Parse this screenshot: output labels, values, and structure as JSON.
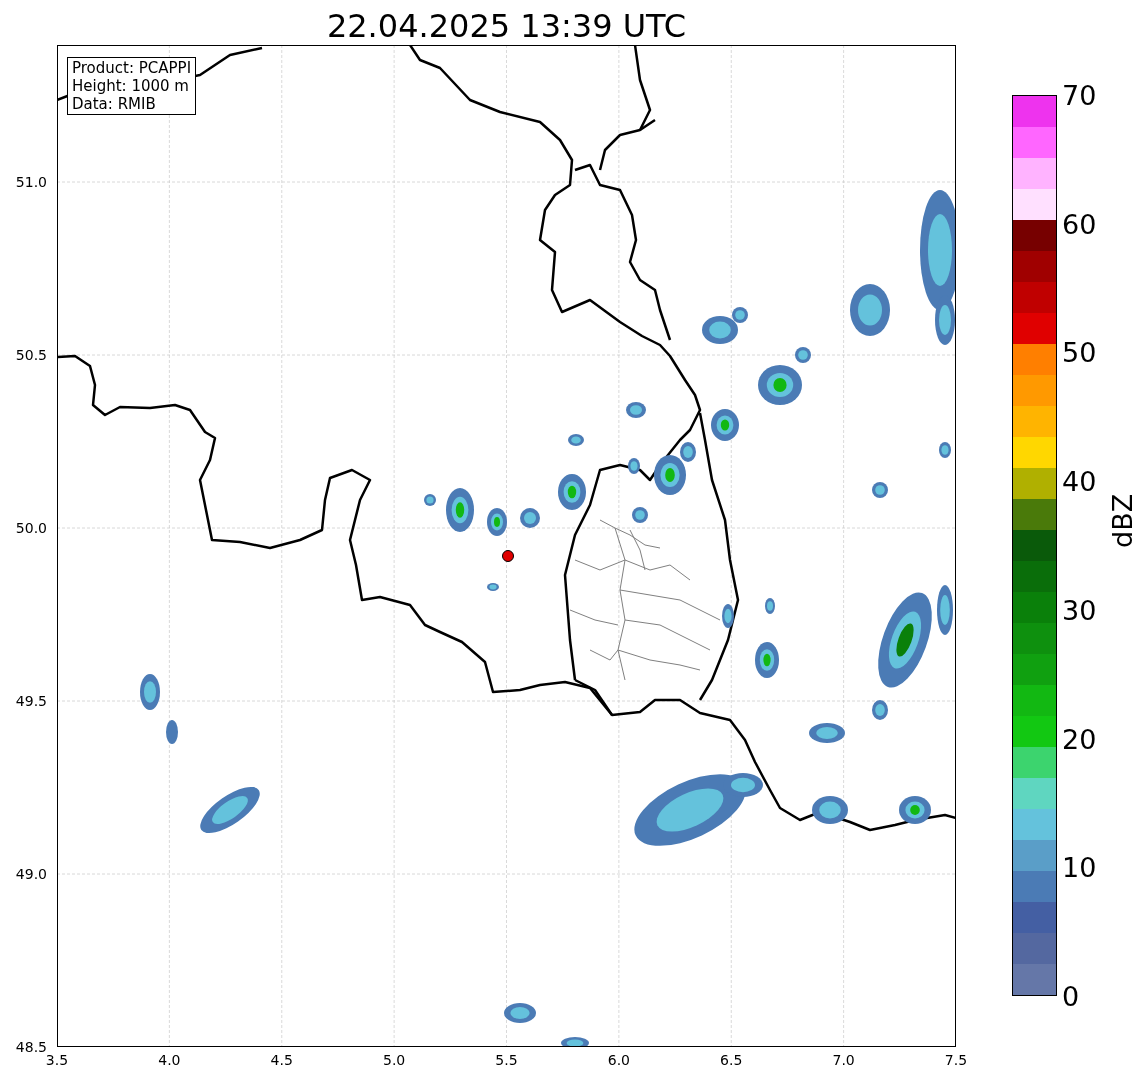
{
  "title": "22.04.2025 13:39 UTC",
  "info_box": [
    "Product: PCAPPI",
    "Height: 1000 m",
    "Data: RMIB"
  ],
  "map": {
    "xticks": [
      "3.5",
      "4.0",
      "4.5",
      "5.0",
      "5.5",
      "6.0",
      "6.5",
      "7.0",
      "7.5"
    ],
    "yticks": [
      "51.0",
      "50.5",
      "50.0",
      "49.5",
      "49.0",
      "48.5"
    ]
  },
  "colorbar": {
    "label": "dBZ",
    "ticks": [
      "70",
      "60",
      "50",
      "40",
      "30",
      "20",
      "10",
      "0"
    ],
    "bins": [
      {
        "color": "#ee33ee"
      },
      {
        "color": "#ff66ff"
      },
      {
        "color": "#ffb3ff"
      },
      {
        "color": "#ffe0ff"
      },
      {
        "color": "#770000"
      },
      {
        "color": "#a00000"
      },
      {
        "color": "#c00000"
      },
      {
        "color": "#e00000"
      },
      {
        "color": "#ff7f00"
      },
      {
        "color": "#ff9900"
      },
      {
        "color": "#ffb400"
      },
      {
        "color": "#ffd700"
      },
      {
        "color": "#b0b000"
      },
      {
        "color": "#4a7a0a"
      },
      {
        "color": "#0a5a0a"
      },
      {
        "color": "#0a6e0a"
      },
      {
        "color": "#0a800a"
      },
      {
        "color": "#0e900e"
      },
      {
        "color": "#10a010"
      },
      {
        "color": "#12b812"
      },
      {
        "color": "#12c812"
      },
      {
        "color": "#3cd46e"
      },
      {
        "color": "#5fd6c0"
      },
      {
        "color": "#64c2dc"
      },
      {
        "color": "#5a9ec8"
      },
      {
        "color": "#4b7bb5"
      },
      {
        "color": "#445fa3"
      },
      {
        "color": "#5468a0"
      },
      {
        "color": "#6577a8"
      }
    ]
  }
}
